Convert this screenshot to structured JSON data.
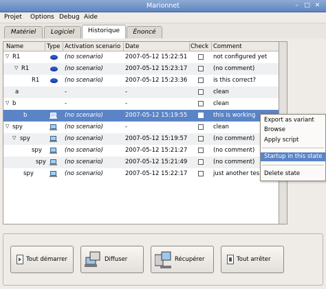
{
  "window": {
    "title": "Marionnet"
  },
  "menu": {
    "items": [
      "Projet",
      "Options",
      "Debug",
      "Aide"
    ]
  },
  "tabs": [
    {
      "label": "Matériel"
    },
    {
      "label": "Logiciel"
    },
    {
      "label": "Historique"
    },
    {
      "label": "Énoncé"
    }
  ],
  "table": {
    "headers": {
      "name": "Name",
      "type": "Type",
      "activation": "Activation scenario",
      "date": "Date",
      "check": "Check",
      "comment": "Comment"
    },
    "rows": [
      {
        "name": "R1",
        "icon": "disk-icon",
        "activation": "(no scenario)",
        "date": "2007-05-12 15:22:51",
        "comment": "not configured yet"
      },
      {
        "name": "R1",
        "icon": "disk-icon",
        "activation": "(no scenario)",
        "date": "2007-05-12 15:23:17",
        "comment": "(no comment)"
      },
      {
        "name": "R1",
        "icon": "disk-icon",
        "activation": "(no scenario)",
        "date": "2007-05-12 15:23:36",
        "comment": "is this correct?"
      },
      {
        "name": "a",
        "icon": "",
        "activation": "-",
        "date": "-",
        "comment": "clean"
      },
      {
        "name": "b",
        "icon": "",
        "activation": "-",
        "date": "-",
        "comment": "clean"
      },
      {
        "name": "b",
        "icon": "laptop-icon",
        "activation": "(no scenario)",
        "date": "2007-05-12 15:19:55",
        "comment": "this is working"
      },
      {
        "name": "spy",
        "icon": "laptop-icon",
        "activation": "(no scenario)",
        "date": "-",
        "comment": "clean"
      },
      {
        "name": "spy",
        "icon": "laptop-icon",
        "activation": "(no scenario)",
        "date": "2007-05-12 15:19:57",
        "comment": "(no comment)"
      },
      {
        "name": "spy",
        "icon": "laptop-icon",
        "activation": "(no scenario)",
        "date": "2007-05-12 15:21:27",
        "comment": "(no comment)"
      },
      {
        "name": "spy",
        "icon": "laptop-icon",
        "activation": "(no scenario)",
        "date": "2007-05-12 15:21:49",
        "comment": "(no comment)"
      },
      {
        "name": "spy",
        "icon": "laptop-icon",
        "activation": "(no scenario)",
        "date": "2007-05-12 15:22:17",
        "comment": "just another tes"
      }
    ]
  },
  "context_menu": {
    "items": [
      "Export as variant",
      "Browse",
      "Apply script",
      "Startup in this state",
      "Delete state"
    ]
  },
  "buttons": {
    "start_all": "Tout démarrer",
    "broadcast": "Diffuser",
    "retrieve": "Récupérer",
    "stop_all": "Tout arrêter"
  },
  "colors": {
    "selection": "#5a84c6",
    "titlebar": "#6f93c8"
  }
}
